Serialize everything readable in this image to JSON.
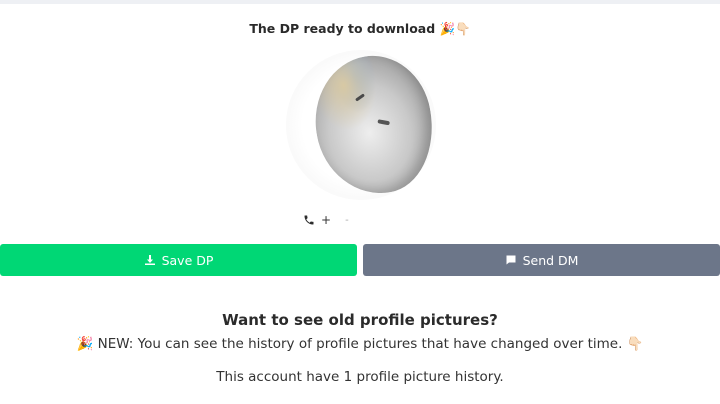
{
  "header": {
    "title": "The DP ready to download 🎉👇🏻"
  },
  "profile": {
    "phone_prefix": "+",
    "phone_number": "-"
  },
  "actions": {
    "save_label": "Save DP",
    "dm_label": "Send DM"
  },
  "history": {
    "heading": "Want to see old profile pictures?",
    "note": "🎉 NEW: You can see the history of profile pictures that have changed over time. 👇🏻",
    "count_text": "This account have 1 profile picture history."
  },
  "colors": {
    "save_button": "#00d775",
    "dm_button": "#6c7689"
  },
  "icons": {
    "phone": "phone-icon",
    "save": "download-icon",
    "dm": "message-icon"
  }
}
